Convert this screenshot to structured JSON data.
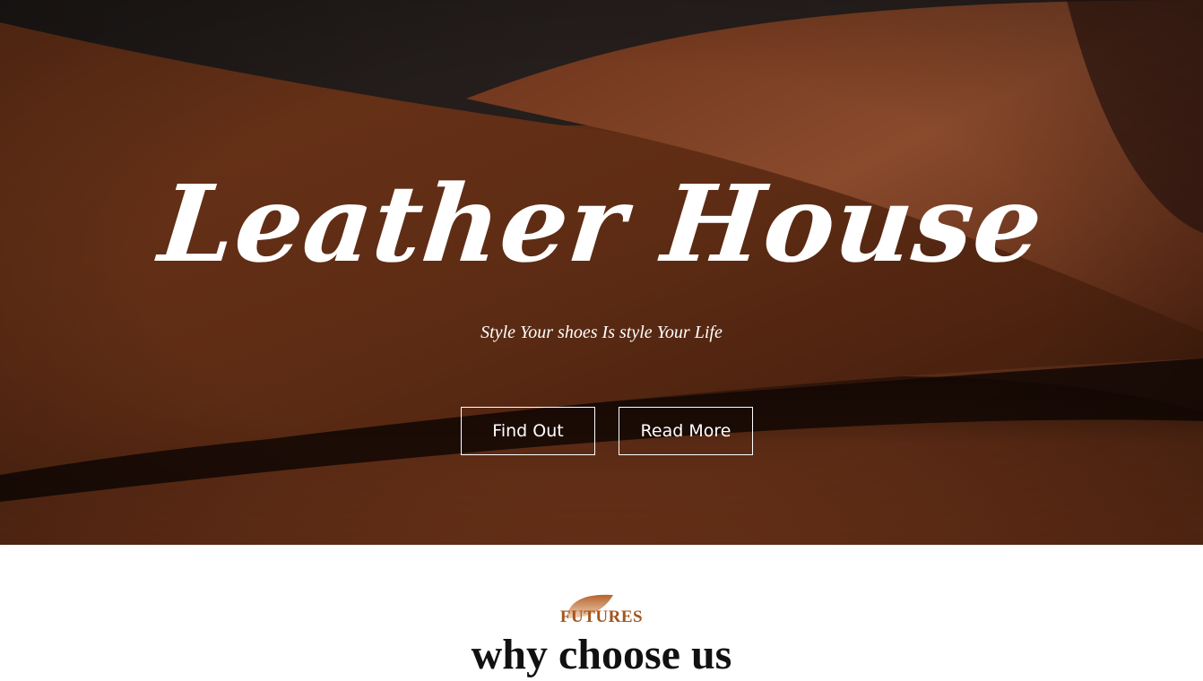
{
  "hero": {
    "title": "Leather House",
    "subtitle": "Style Your shoes Is style Your Life",
    "buttons": {
      "find_out": "Find Out",
      "read_more": "Read More"
    },
    "background_image": "leather-fabric-photo"
  },
  "features": {
    "icon": "leaf-icon",
    "tagline": "FUTURES",
    "title": "why choose us"
  },
  "colors": {
    "accent": "#a3551c",
    "leather_dark": "#3b1a0c",
    "leather_mid": "#6b3219",
    "leather_light": "#8a4422"
  }
}
